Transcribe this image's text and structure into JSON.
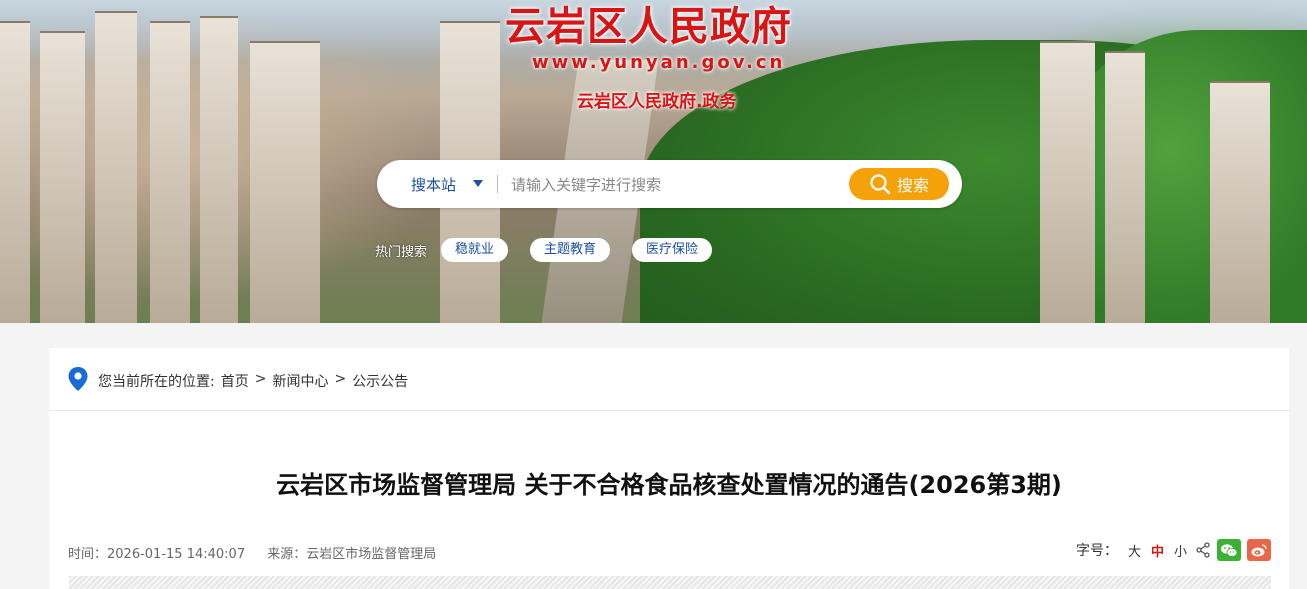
{
  "header": {
    "site_title": "云岩区人民政府",
    "site_url": "www.yunyan.gov.cn",
    "site_subtitle": "云岩区人民政府.政务"
  },
  "search": {
    "scope_label": "搜本站",
    "placeholder": "请输入关键字进行搜索",
    "button_label": "搜索",
    "hot_label": "热门搜索",
    "hot_tags": [
      "稳就业",
      "主题教育",
      "医疗保险"
    ]
  },
  "breadcrumb": {
    "prefix": "您当前所在的位置:",
    "items": [
      "首页",
      "新闻中心",
      "公示公告"
    ],
    "separator": ">"
  },
  "article": {
    "title": "云岩区市场监督管理局 关于不合格食品核查处置情况的通告(2026第3期)",
    "time_label": "时间：",
    "time": "2026-01-15 14:40:07",
    "source_label": "来源：",
    "source": "云岩区市场监督管理局",
    "font_size_label": "字号：",
    "font_sizes": [
      "大",
      "中",
      "小"
    ],
    "active_font_size": "中"
  },
  "colors": {
    "brand_red": "#d81414",
    "accent_orange": "#f5a20a",
    "link_blue": "#1a4fa3"
  }
}
